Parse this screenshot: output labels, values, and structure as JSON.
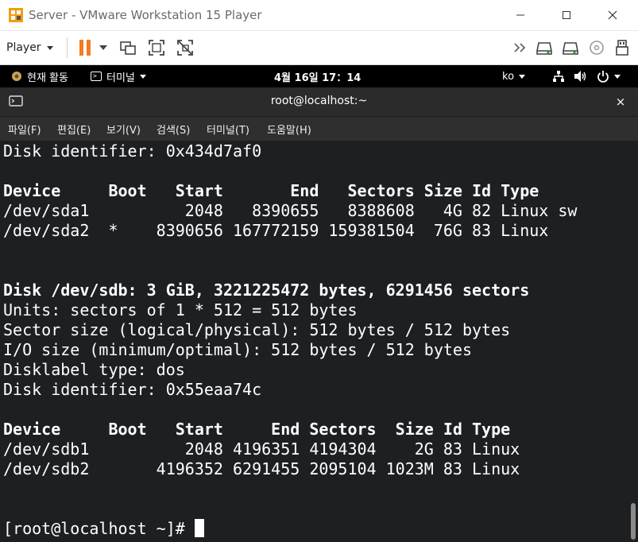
{
  "window": {
    "title": "Server - VMware Workstation 15 Player"
  },
  "toolbar": {
    "player_label": "Player",
    "icons": [
      "pause-icon",
      "dropdown-icon",
      "send-ctrl-alt-del-icon",
      "fullscreen-icon",
      "unity-icon",
      "more-icon",
      "disk-icon",
      "disk-icon",
      "cd-icon",
      "usb-icon"
    ]
  },
  "gnome_bar": {
    "activities": "현재 활동",
    "app_menu": "터미널",
    "clock": "4월 16일  17：14",
    "language": "ko"
  },
  "terminal_window": {
    "title": "root@localhost:~",
    "close_glyph": "×",
    "menus": [
      "파일(F)",
      "편집(E)",
      "보기(V)",
      "검색(S)",
      "터미널(T)",
      "도움말(H)"
    ]
  },
  "terminal": {
    "lines": [
      "Disk identifier: 0x434d7af0",
      "",
      "Device     Boot   Start       End   Sectors Size Id Type",
      "/dev/sda1          2048   8390655   8388608   4G 82 Linux sw",
      "/dev/sda2  *    8390656 167772159 159381504  76G 83 Linux",
      "",
      "",
      "Disk /dev/sdb: 3 GiB, 3221225472 bytes, 6291456 sectors",
      "Units: sectors of 1 * 512 = 512 bytes",
      "Sector size (logical/physical): 512 bytes / 512 bytes",
      "I/O size (minimum/optimal): 512 bytes / 512 bytes",
      "Disklabel type: dos",
      "Disk identifier: 0x55eaa74c",
      "",
      "Device     Boot   Start     End Sectors  Size Id Type",
      "/dev/sdb1          2048 4196351 4194304    2G 83 Linux",
      "/dev/sdb2       4196352 6291455 2095104 1023M 83 Linux",
      "",
      "",
      "[root@localhost ~]# "
    ]
  },
  "colors": {
    "terminal_bg": "#1d1f21",
    "terminal_fg": "#ffffff",
    "pause_orange": "#f47b20",
    "gnome_bar_bg": "#000000"
  }
}
